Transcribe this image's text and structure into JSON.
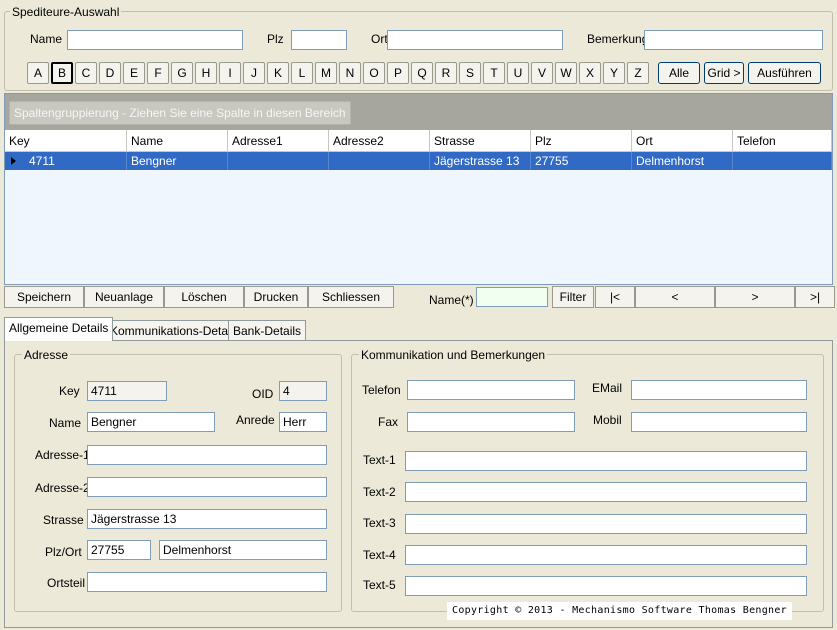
{
  "search": {
    "group_title": "Spediteure-Auswahl",
    "name_label": "Name",
    "name_value": "",
    "plz_label": "Plz",
    "plz_value": "",
    "ort_label": "Ort",
    "ort_value": "",
    "bemerkung_label": "Bemerkung",
    "bemerkung_value": "",
    "letters": [
      "A",
      "B",
      "C",
      "D",
      "E",
      "F",
      "G",
      "H",
      "I",
      "J",
      "K",
      "L",
      "M",
      "N",
      "O",
      "P",
      "Q",
      "R",
      "S",
      "T",
      "U",
      "V",
      "W",
      "X",
      "Y",
      "Z"
    ],
    "selected_letter": "B",
    "alle_label": "Alle",
    "grid_label": "Grid >",
    "ausfuehren_label": "Ausführen"
  },
  "grid": {
    "group_hint": "Spaltengruppierung - Ziehen Sie eine Spalte in diesen Bereich",
    "columns": [
      "Key",
      "Name",
      "Adresse1",
      "Adresse2",
      "Strasse",
      "Plz",
      "Ort",
      "Telefon"
    ],
    "rows": [
      [
        "4711",
        "Bengner",
        "",
        "",
        "Jägerstrasse 13",
        "27755",
        "Delmenhorst",
        ""
      ]
    ]
  },
  "commands": {
    "speichern": "Speichern",
    "neuanlage": "Neuanlage",
    "loeschen": "Löschen",
    "drucken": "Drucken",
    "schliessen": "Schliessen",
    "filter_name_label": "Name(*)",
    "filter_value": "",
    "filter_button": "Filter",
    "nav_first": "|<",
    "nav_prev": "<",
    "nav_next": ">",
    "nav_last": ">|"
  },
  "tabs": [
    "Allgemeine Details",
    "Kommunikations-Details",
    "Bank-Details"
  ],
  "adresse": {
    "title": "Adresse",
    "key_label": "Key",
    "key_value": "4711",
    "oid_label": "OID",
    "oid_value": "4",
    "name_label": "Name",
    "name_value": "Bengner",
    "anrede_label": "Anrede",
    "anrede_value": "Herr",
    "adresse1_label": "Adresse-1",
    "adresse1_value": "",
    "adresse2_label": "Adresse-2",
    "adresse2_value": "",
    "strasse_label": "Strasse",
    "strasse_value": "Jägerstrasse 13",
    "plzort_label": "Plz/Ort",
    "plz_value": "27755",
    "ort_value": "Delmenhorst",
    "ortsteil_label": "Ortsteil",
    "ortsteil_value": ""
  },
  "kommunikation": {
    "title": "Kommunikation und Bemerkungen",
    "telefon_label": "Telefon",
    "telefon_value": "",
    "email_label": "EMail",
    "email_value": "",
    "fax_label": "Fax",
    "fax_value": "",
    "mobil_label": "Mobil",
    "mobil_value": "",
    "text1_label": "Text-1",
    "text1_value": "",
    "text2_label": "Text-2",
    "text2_value": "",
    "text3_label": "Text-3",
    "text3_value": "",
    "text4_label": "Text-4",
    "text4_value": "",
    "text5_label": "Text-5",
    "text5_value": ""
  },
  "copyright": "Copyright © 2013 - Mechanismo Software Thomas Bengner"
}
